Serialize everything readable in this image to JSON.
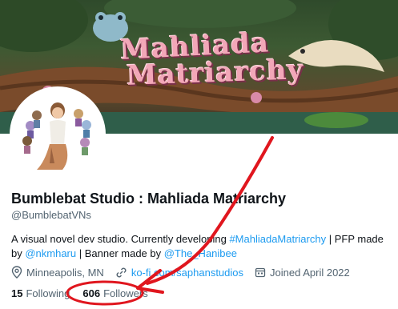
{
  "banner": {
    "title_line1": "Mahliada",
    "title_line2": "Matriarchy"
  },
  "profile": {
    "display_name": "Bumblebat Studio : Mahliada Matriarchy",
    "handle": "@BumblebatVNs",
    "bio": {
      "text1": "A visual novel dev studio. Currently developing ",
      "hashtag": "#MahliadaMatriarchy",
      "text2": " | PFP made by ",
      "mention1": "@nkmharu",
      "text3": " | Banner made by ",
      "mention2": "@The_Hanibee"
    },
    "location": "Minneapolis, MN",
    "website": "ko-fi.com/saphanstudios",
    "joined": "Joined April 2022",
    "following_count": "15",
    "following_label": "Following",
    "followers_count": "606",
    "followers_label": "Followers"
  },
  "colors": {
    "link": "#1d9bf0",
    "annotation": "#e0161e"
  },
  "icons": [
    "location-icon",
    "link-icon",
    "calendar-icon"
  ]
}
